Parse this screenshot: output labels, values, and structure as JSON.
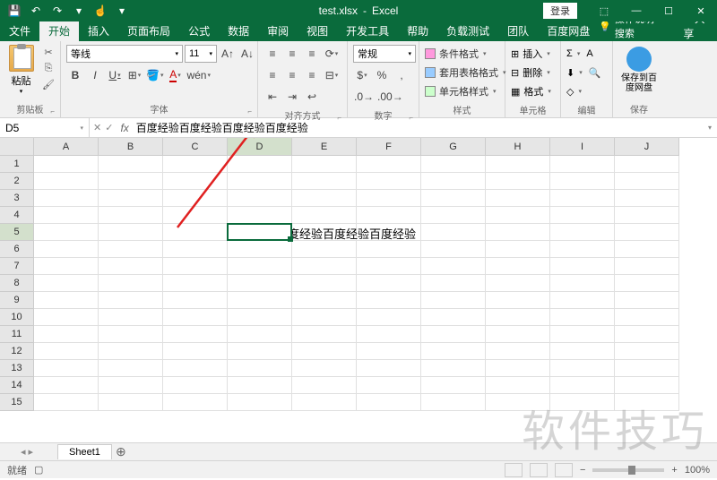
{
  "title": {
    "filename": "test.xlsx",
    "app": "Excel"
  },
  "titlebar": {
    "login": "登录",
    "share": "共享"
  },
  "tabs": {
    "file": "文件",
    "home": "开始",
    "insert": "插入",
    "layout": "页面布局",
    "formulas": "公式",
    "data": "数据",
    "review": "审阅",
    "view": "视图",
    "dev": "开发工具",
    "help": "帮助",
    "load": "负载测试",
    "team": "团队",
    "baidu": "百度网盘",
    "tellme": "操作说明搜索"
  },
  "ribbon": {
    "clipboard": {
      "label": "剪贴板",
      "paste": "粘贴"
    },
    "font": {
      "label": "字体",
      "name": "等线",
      "size": "11",
      "bold": "B",
      "italic": "I",
      "underline": "U"
    },
    "align": {
      "label": "对齐方式"
    },
    "number": {
      "label": "数字",
      "format": "常规"
    },
    "styles": {
      "label": "样式",
      "cond": "条件格式",
      "table": "套用表格格式",
      "cell": "单元格样式"
    },
    "cells": {
      "label": "单元格",
      "insert": "插入",
      "delete": "删除",
      "format": "格式"
    },
    "edit": {
      "label": "编辑"
    },
    "save": {
      "label": "保存",
      "btn": "保存到百度网盘"
    }
  },
  "namebox": {
    "ref": "D5"
  },
  "formula": {
    "value": "百度经验百度经验百度经验百度经验"
  },
  "columns": [
    "A",
    "B",
    "C",
    "D",
    "E",
    "F",
    "G",
    "H",
    "I",
    "J"
  ],
  "rows": [
    "1",
    "2",
    "3",
    "4",
    "5",
    "6",
    "7",
    "8",
    "9",
    "10",
    "11",
    "12",
    "13",
    "14",
    "15"
  ],
  "activeCell": {
    "row": 5,
    "col": "D",
    "value": "百度经验百度经验百度经验百度经验"
  },
  "sheets": {
    "active": "Sheet1"
  },
  "status": {
    "ready": "就绪",
    "zoom": "100%"
  },
  "watermark": "软件技巧"
}
